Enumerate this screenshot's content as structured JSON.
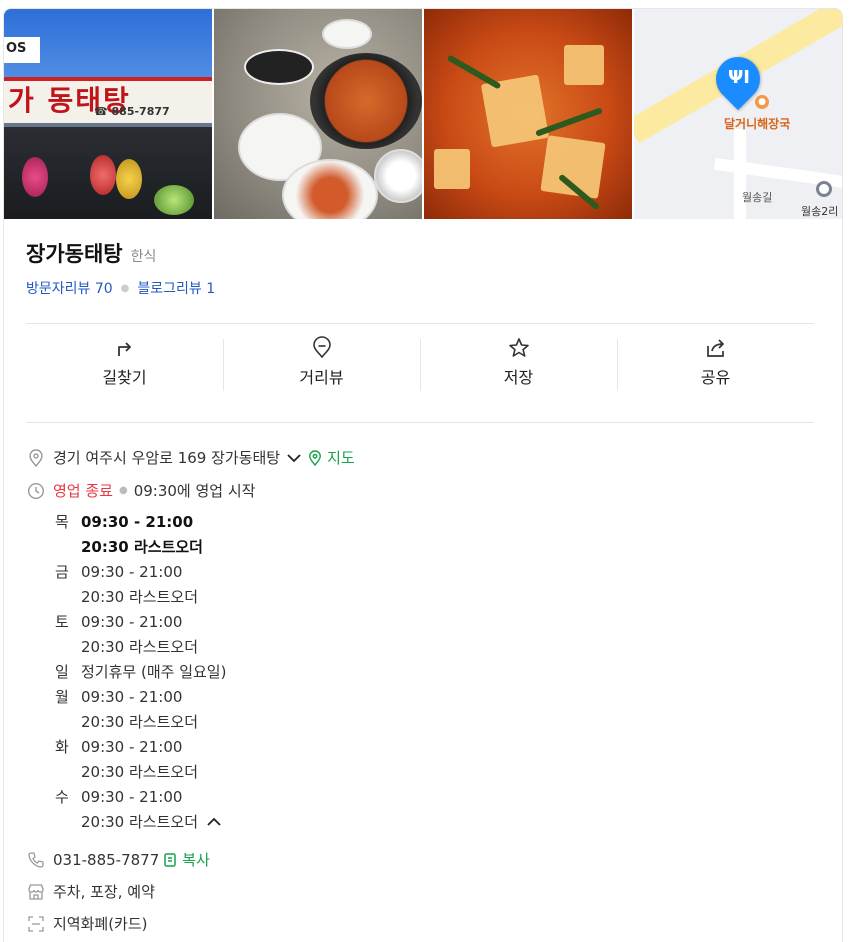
{
  "photos": {
    "store": {
      "sign_text": "가 동태탕",
      "sign_phone": "☎ 885-7877",
      "os_label": "OS"
    },
    "map": {
      "poi_label": "달거니해장국",
      "road_label": "월송길",
      "station_label": "월송2리"
    }
  },
  "place": {
    "name": "장가동태탕",
    "category": "한식",
    "visitor_reviews": "방문자리뷰 70",
    "blog_reviews": "블로그리뷰 1"
  },
  "actions": [
    {
      "label": "길찾기",
      "icon": "directions-icon"
    },
    {
      "label": "거리뷰",
      "icon": "street-view-icon"
    },
    {
      "label": "저장",
      "icon": "star-icon"
    },
    {
      "label": "공유",
      "icon": "share-icon"
    }
  ],
  "address": {
    "text": "경기 여주시 우암로 169 장가동태탕",
    "map_link": "지도"
  },
  "status": {
    "state": "영업 종료",
    "next": "09:30에 영업 시작"
  },
  "hours": [
    {
      "day": "목",
      "time": "09:30 - 21:00",
      "last_order": "20:30 라스트오더",
      "today": true
    },
    {
      "day": "금",
      "time": "09:30 - 21:00",
      "last_order": "20:30 라스트오더",
      "today": false
    },
    {
      "day": "토",
      "time": "09:30 - 21:00",
      "last_order": "20:30 라스트오더",
      "today": false
    },
    {
      "day": "일",
      "time": "정기휴무 (매주 일요일)",
      "last_order": "",
      "today": false
    },
    {
      "day": "월",
      "time": "09:30 - 21:00",
      "last_order": "20:30 라스트오더",
      "today": false
    },
    {
      "day": "화",
      "time": "09:30 - 21:00",
      "last_order": "20:30 라스트오더",
      "today": false
    },
    {
      "day": "수",
      "time": "09:30 - 21:00",
      "last_order": "20:30 라스트오더",
      "today": false
    }
  ],
  "phone": {
    "number": "031-885-7877",
    "copy_label": "복사"
  },
  "amenities": "주차, 포장, 예약",
  "payment": "지역화폐(카드)",
  "colors": {
    "link_blue": "#2459c5",
    "green": "#15a34a",
    "closed_red": "#e63946",
    "pin_blue": "#1a8cff"
  }
}
